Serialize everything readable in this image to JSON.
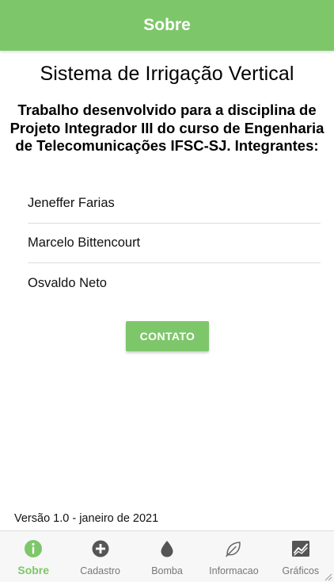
{
  "header": {
    "title": "Sobre"
  },
  "main": {
    "title": "Sistema de Irrigação Vertical",
    "description": "Trabalho desenvolvido para a disciplina de Projeto Integrador III do curso de Engenharia de Telecomunicações IFSC-SJ. Integrantes:",
    "members": [
      "Jeneffer Farias",
      "Marcelo Bittencourt",
      "Osvaldo Neto"
    ],
    "contact_label": "CONTATO"
  },
  "footer": {
    "version": "Versão 1.0 - janeiro de 2021"
  },
  "tabs": [
    {
      "label": "Sobre",
      "icon": "info-icon",
      "active": true
    },
    {
      "label": "Cadastro",
      "icon": "add-circle-icon",
      "active": false
    },
    {
      "label": "Bomba",
      "icon": "water-drop-icon",
      "active": false
    },
    {
      "label": "Informacao",
      "icon": "leaf-icon",
      "active": false
    },
    {
      "label": "Gráficos",
      "icon": "chart-icon",
      "active": false
    }
  ],
  "colors": {
    "accent": "#7ec66a",
    "inactive": "#555555"
  }
}
